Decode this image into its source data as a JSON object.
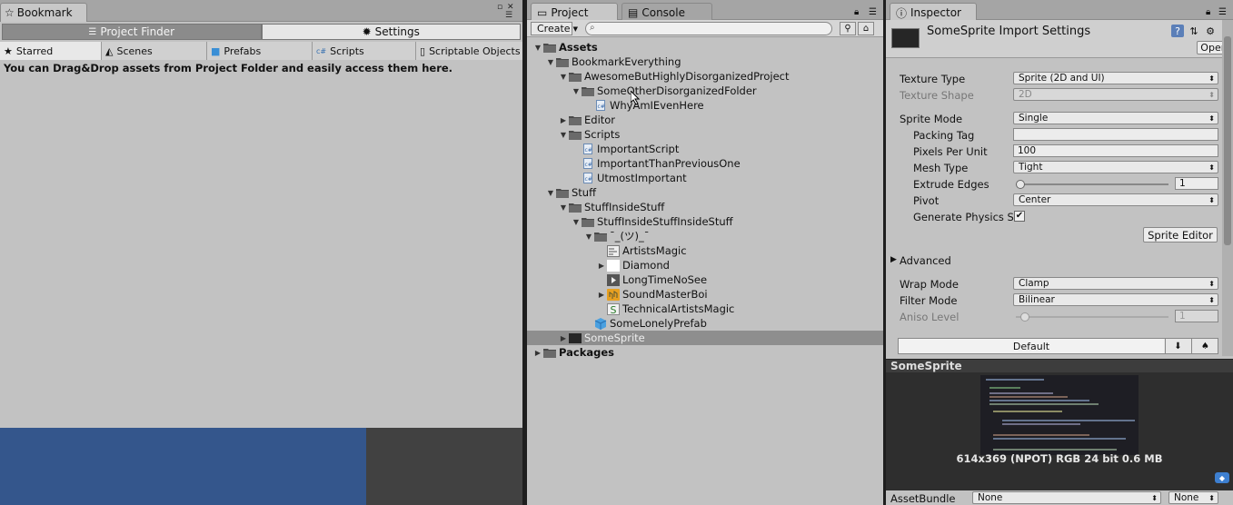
{
  "bookmark": {
    "title": "Bookmark",
    "seg_project_finder": "Project Finder",
    "seg_settings": "Settings",
    "tabs": [
      "Starred",
      "Scenes",
      "Prefabs",
      "Scripts",
      "Scriptable Objects"
    ],
    "message": "You can Drag&Drop assets from Project Folder and easily access them here."
  },
  "project": {
    "tab_project": "Project",
    "tab_console": "Console",
    "create_label": "Create",
    "tree": [
      {
        "label": "Assets",
        "bold": true
      },
      {
        "label": "BookmarkEverything"
      },
      {
        "label": "AwesomeButHighlyDisorganizedProject"
      },
      {
        "label": "SomeOtherDisorganizedFolder"
      },
      {
        "label": "WhyAmIEvenHere"
      },
      {
        "label": "Editor"
      },
      {
        "label": "Scripts"
      },
      {
        "label": "ImportantScript"
      },
      {
        "label": "ImportantThanPreviousOne"
      },
      {
        "label": "UtmostImportant"
      },
      {
        "label": "Stuff"
      },
      {
        "label": "StuffInsideStuff"
      },
      {
        "label": "StuffInsideStuffInsideStuff"
      },
      {
        "label": "¯_(ツ)_¯"
      },
      {
        "label": "ArtistsMagic"
      },
      {
        "label": "Diamond"
      },
      {
        "label": "LongTimeNoSee"
      },
      {
        "label": "SoundMasterBoi"
      },
      {
        "label": "TechnicalArtistsMagic"
      },
      {
        "label": "SomeLonelyPrefab"
      },
      {
        "label": "SomeSprite",
        "selected": true
      },
      {
        "label": "Packages",
        "bold": true
      }
    ]
  },
  "inspector": {
    "tab_label": "Inspector",
    "title": "SomeSprite Import Settings",
    "open_label": "Open",
    "texture_type_label": "Texture Type",
    "texture_type_value": "Sprite (2D and UI)",
    "texture_shape_label": "Texture Shape",
    "texture_shape_value": "2D",
    "sprite_mode_label": "Sprite Mode",
    "sprite_mode_value": "Single",
    "packing_tag_label": "Packing Tag",
    "packing_tag_value": "",
    "ppu_label": "Pixels Per Unit",
    "ppu_value": "100",
    "mesh_type_label": "Mesh Type",
    "mesh_type_value": "Tight",
    "extrude_label": "Extrude Edges",
    "extrude_value": "1",
    "pivot_label": "Pivot",
    "pivot_value": "Center",
    "physics_label": "Generate Physics S",
    "sprite_editor_label": "Sprite Editor",
    "advanced_label": "Advanced",
    "wrap_label": "Wrap Mode",
    "wrap_value": "Clamp",
    "filter_label": "Filter Mode",
    "filter_value": "Bilinear",
    "aniso_label": "Aniso Level",
    "aniso_value": "1",
    "platform_default": "Default",
    "preview_title": "SomeSprite",
    "preview_info": "614x369 (NPOT)  RGB 24 bit   0.6 MB",
    "assetbundle_label": "AssetBundle",
    "assetbundle_value": "None",
    "assetbundle_variant": "None"
  }
}
